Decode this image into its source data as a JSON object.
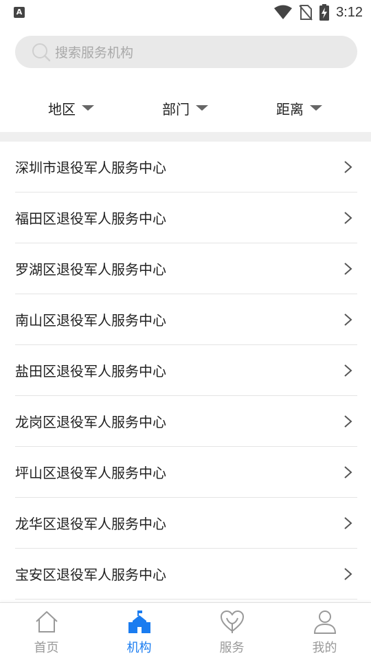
{
  "status_bar": {
    "time": "3:12",
    "notification_letter": "A"
  },
  "search": {
    "placeholder": "搜索服务机构"
  },
  "filters": [
    {
      "label": "地区"
    },
    {
      "label": "部门"
    },
    {
      "label": "距离"
    }
  ],
  "list": [
    "深圳市退役军人服务中心",
    "福田区退役军人服务中心",
    "罗湖区退役军人服务中心",
    "南山区退役军人服务中心",
    "盐田区退役军人服务中心",
    "龙岗区退役军人服务中心",
    "坪山区退役军人服务中心",
    "龙华区退役军人服务中心",
    "宝安区退役军人服务中心"
  ],
  "tabs": [
    {
      "label": "首页",
      "icon": "home-icon",
      "active": false
    },
    {
      "label": "机构",
      "icon": "institution-icon",
      "active": true
    },
    {
      "label": "服务",
      "icon": "service-heart-icon",
      "active": false
    },
    {
      "label": "我的",
      "icon": "profile-icon",
      "active": false
    }
  ],
  "colors": {
    "accent": "#1a7cf0",
    "inactive": "#999999",
    "search_bg": "#e9e9e9"
  }
}
